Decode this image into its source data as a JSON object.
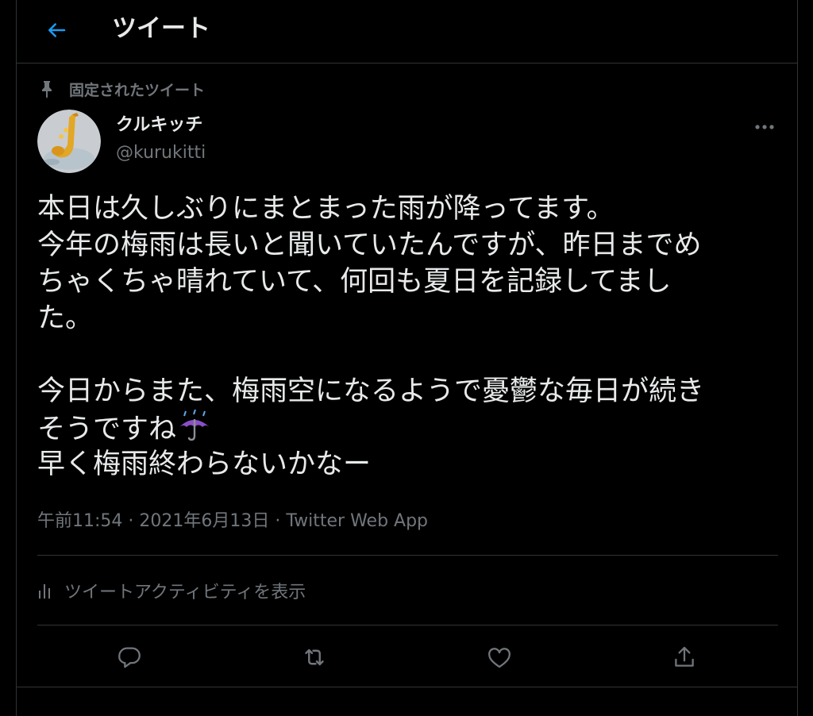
{
  "header": {
    "title": "ツイート",
    "back_icon": "arrow-left-icon"
  },
  "pinned": {
    "label": "固定されたツイート",
    "icon": "pin-icon"
  },
  "author": {
    "display_name": "クルキッチ",
    "username": "@kurukitti",
    "avatar_icon": "saxophone-avatar"
  },
  "tweet": {
    "lines": [
      "本日は久しぶりにまとまった雨が降ってます。",
      "今年の梅雨は長いと聞いていたんですが、昨日までめ",
      "ちゃくちゃ晴れていて、何回も夏日を記録してまし",
      "た。",
      "",
      "今日からまた、梅雨空になるようで憂鬱な毎日が続き",
      "そうですね",
      "早く梅雨終わらないかなー"
    ],
    "emoji": "☔"
  },
  "meta": {
    "time": "午前11:54",
    "separator": " · ",
    "date": "2021年6月13日",
    "source": "Twitter Web App"
  },
  "activity": {
    "label": "ツイートアクティビティを表示",
    "icon": "analytics-bars-icon"
  },
  "actions": [
    {
      "name": "reply",
      "icon": "reply-bubble-icon"
    },
    {
      "name": "retweet",
      "icon": "retweet-icon"
    },
    {
      "name": "like",
      "icon": "heart-icon"
    },
    {
      "name": "share",
      "icon": "share-upload-icon"
    }
  ],
  "colors": {
    "background": "#000000",
    "text_primary": "#e7e9ea",
    "text_secondary": "#71767b",
    "accent": "#1d9bf0",
    "border": "#2f3336"
  }
}
